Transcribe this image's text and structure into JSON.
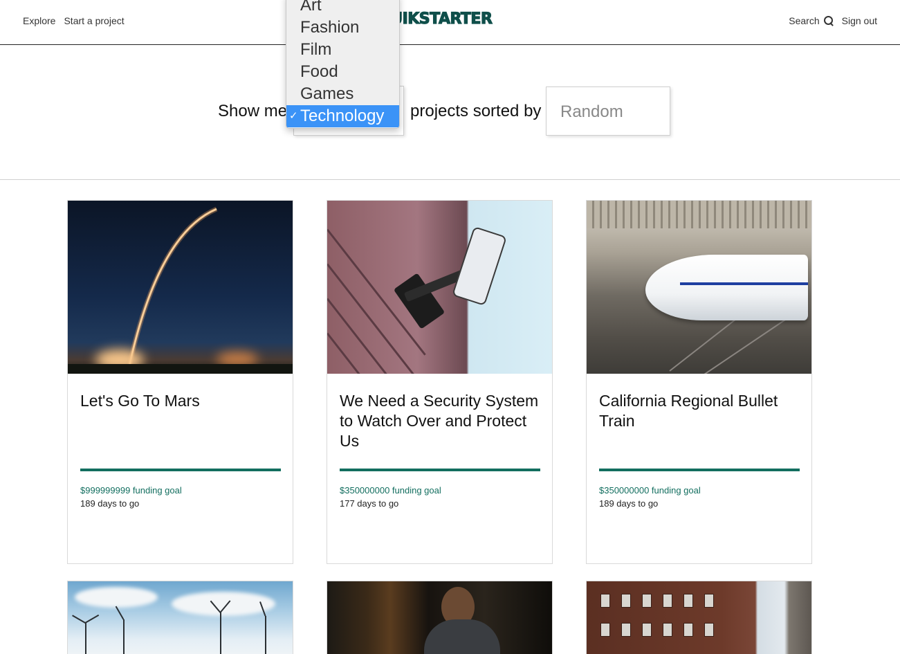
{
  "header": {
    "nav_left": [
      "Explore",
      "Start a project"
    ],
    "logo": "QUIKSTARTER",
    "search_label": "Search",
    "signout_label": "Sign out"
  },
  "filter": {
    "show_me": "Show me",
    "sorted_by": "projects sorted by",
    "sort_value": "Random",
    "category_options": [
      "Art",
      "Fashion",
      "Film",
      "Food",
      "Games",
      "Technology"
    ],
    "selected_category": "Technology",
    "checkmark": "✓"
  },
  "projects": [
    {
      "title": "Let's Go To Mars",
      "goal": "$999999999 funding goal",
      "days": "189 days to go",
      "progress": 1.0,
      "image": "rocket-launch"
    },
    {
      "title": "We Need a Security System to Watch Over and Protect Us",
      "goal": "$350000000 funding goal",
      "days": "177 days to go",
      "progress": 1.0,
      "image": "security-camera"
    },
    {
      "title": "California Regional Bullet Train",
      "goal": "$350000000 funding goal",
      "days": "189 days to go",
      "progress": 1.0,
      "image": "bullet-train"
    },
    {
      "title": "",
      "goal": "",
      "days": "",
      "image": "wind-turbines"
    },
    {
      "title": "",
      "goal": "",
      "days": "",
      "image": "person-dark-room"
    },
    {
      "title": "",
      "goal": "",
      "days": "",
      "image": "brick-building"
    }
  ],
  "colors": {
    "accent": "#126e5f",
    "logo": "#0f4f4a",
    "dropdown_selected": "#3b93f7"
  }
}
